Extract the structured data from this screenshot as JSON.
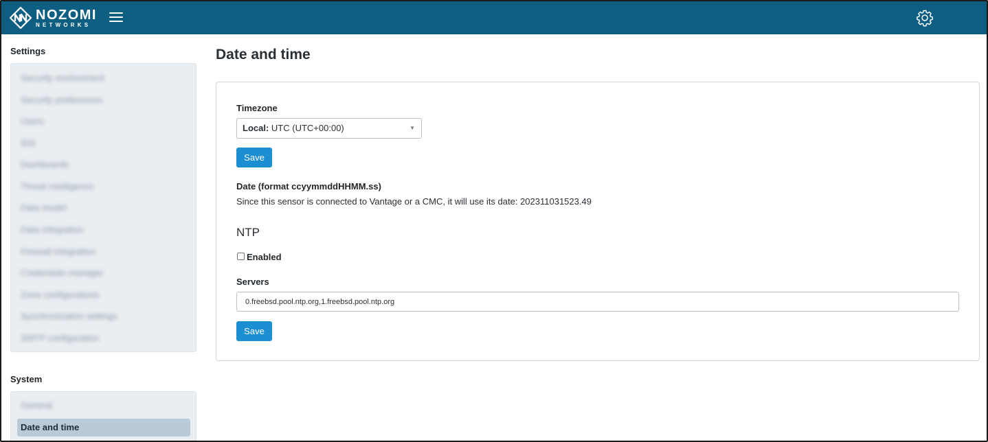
{
  "header": {
    "brand_main": "NOZOMI",
    "brand_sub": "NETWORKS",
    "menu_icon": "hamburger-menu-icon",
    "settings_icon": "gear-icon",
    "bar_color": "#0d5e80"
  },
  "sidebar": {
    "settings_title": "Settings",
    "settings_items": [
      {
        "label": "Security environment"
      },
      {
        "label": "Security preferences"
      },
      {
        "label": "Users"
      },
      {
        "label": "IDS"
      },
      {
        "label": "Dashboards"
      },
      {
        "label": "Threat intelligence"
      },
      {
        "label": "Data model"
      },
      {
        "label": "Data integration"
      },
      {
        "label": "Firewall integration"
      },
      {
        "label": "Credentials manager"
      },
      {
        "label": "Zone configurations"
      },
      {
        "label": "Synchronization settings"
      },
      {
        "label": "SMTP configuration"
      }
    ],
    "system_title": "System",
    "system_items": [
      {
        "label": "General"
      },
      {
        "label": "Date and time",
        "active": true
      }
    ]
  },
  "main": {
    "title": "Date and time",
    "timezone": {
      "label": "Timezone",
      "selected_prefix": "Local:",
      "selected_value": "UTC (UTC+00:00)"
    },
    "save_label_1": "Save",
    "date": {
      "label": "Date (format ccyymmddHHMM.ss)",
      "info": "Since this sensor is connected to Vantage or a CMC, it will use its date: 202311031523.49"
    },
    "ntp": {
      "heading": "NTP",
      "enabled_label": "Enabled",
      "enabled": false,
      "servers_label": "Servers",
      "servers_value": "0.freebsd.pool.ntp.org,1.freebsd.pool.ntp.org"
    },
    "save_label_2": "Save",
    "accent_color": "#1b8fd1"
  }
}
